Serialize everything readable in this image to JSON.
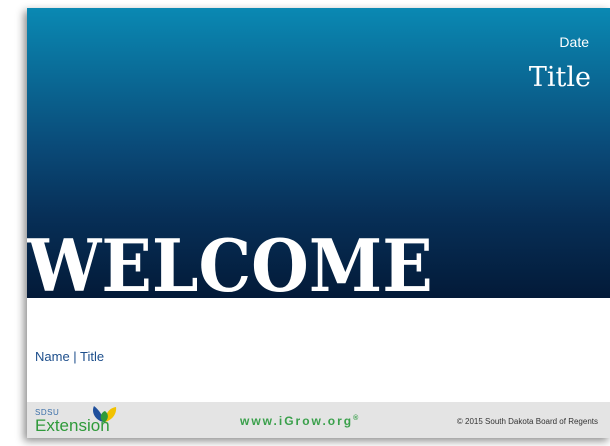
{
  "slide": {
    "date": "Date",
    "title": "Title",
    "welcome": "WELCOME",
    "presenter": "Name | Title"
  },
  "footer": {
    "logo_small": "SDSU",
    "logo_big": "Extension",
    "website_main": "www.iGrow.org",
    "website_mark": "®",
    "copyright": "© 2015 South Dakota Board of Regents"
  },
  "logo_icon": "leaf-logo-icon",
  "colors": {
    "hero_top": "#0a89b3",
    "hero_bottom": "#031a38",
    "presenter_text": "#1e4f8c",
    "footer_bg": "#e4e4e4",
    "website_text": "#3aa04b",
    "logo_green": "#2f9a3a",
    "logo_blue": "#1f4f9c",
    "logo_yellow": "#f2c200"
  }
}
